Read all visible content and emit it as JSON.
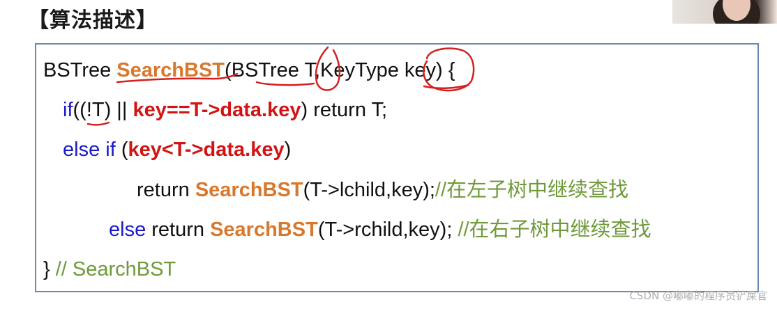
{
  "heading": "【算法描述】",
  "code": {
    "line1": {
      "ret_type": "BSTree ",
      "fn": "SearchBST",
      "params": "(BSTree T,KeyType key) {"
    },
    "line2": {
      "kw": "if",
      "open": "((!T) || ",
      "cond": "key==T->data.key",
      "rest": ") return T;"
    },
    "line3": {
      "kw": "else if",
      "open": " (",
      "cond": "key<T->data.key",
      "close": ")"
    },
    "line4": {
      "pre": "return ",
      "fn": "SearchBST",
      "args": "(T->lchild,key);",
      "comment": "//在左子树中继续查找"
    },
    "line5": {
      "kw": "else",
      "pre": " return ",
      "fn": "SearchBST",
      "args": "(T->rchild,key); ",
      "comment": "//在右子树中继续查找"
    },
    "line6": {
      "brace": "} ",
      "comment": "// SearchBST"
    }
  },
  "watermark": "CSDN @嘟嘟的程序员铲屎官",
  "colors": {
    "keyword": "#1a1ac8",
    "function": "#d9782c",
    "condition": "#d21414",
    "comment": "#6f9a3a",
    "annotation_ink": "#d42020",
    "box_border": "#6b87b4"
  }
}
